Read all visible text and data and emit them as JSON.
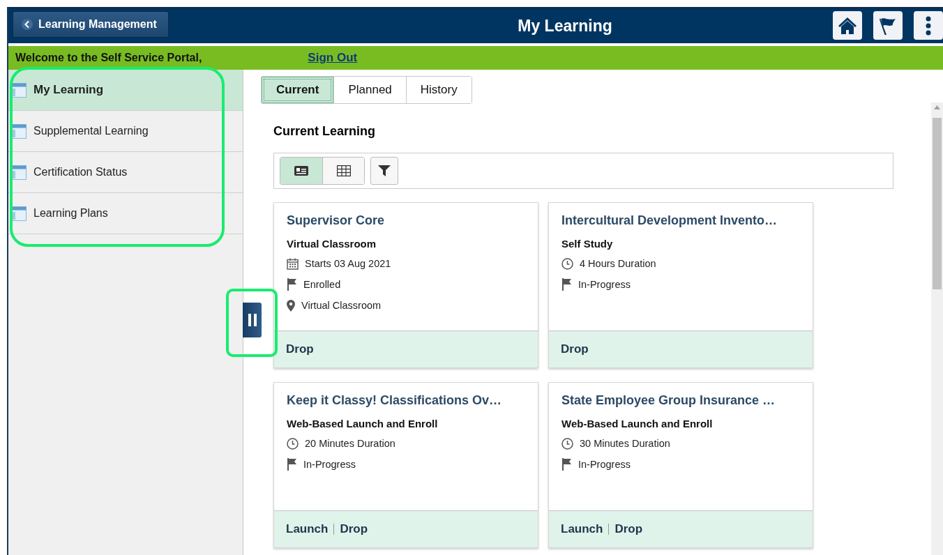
{
  "header": {
    "back_button": "Learning Management",
    "title": "My Learning"
  },
  "welcome_bar": {
    "message": "Welcome to the Self Service Portal,",
    "sign_out": "Sign Out"
  },
  "sidebar": {
    "highlighted": true,
    "items": [
      {
        "label": "My Learning",
        "selected": true
      },
      {
        "label": "Supplemental Learning",
        "selected": false
      },
      {
        "label": "Certification Status",
        "selected": false
      },
      {
        "label": "Learning Plans",
        "selected": false
      }
    ]
  },
  "collapse_handle": {
    "highlighted": true
  },
  "tabs": [
    {
      "label": "Current",
      "selected": true
    },
    {
      "label": "Planned",
      "selected": false
    },
    {
      "label": "History",
      "selected": false
    }
  ],
  "section_title": "Current Learning",
  "view_toggles": [
    {
      "kind": "card",
      "selected": true
    },
    {
      "kind": "grid",
      "selected": false
    }
  ],
  "cards": [
    {
      "title": "Supervisor Core",
      "type": "Virtual Classroom",
      "details": [
        {
          "kind": "calendar",
          "text": "Starts 03 Aug 2021"
        },
        {
          "kind": "flag",
          "text": "Enrolled"
        },
        {
          "kind": "location",
          "text": "Virtual Classroom"
        }
      ],
      "actions": [
        "Drop"
      ]
    },
    {
      "title": "Intercultural Development Invento…",
      "type": "Self Study",
      "details": [
        {
          "kind": "clock",
          "text": "4 Hours Duration"
        },
        {
          "kind": "flag",
          "text": "In-Progress"
        }
      ],
      "actions": [
        "Drop"
      ]
    },
    {
      "title": "Keep it Classy! Classifications Ov…",
      "type": "Web-Based Launch and Enroll",
      "details": [
        {
          "kind": "clock",
          "text": "20 Minutes Duration"
        },
        {
          "kind": "flag",
          "text": "In-Progress"
        }
      ],
      "actions": [
        "Launch",
        "Drop"
      ]
    },
    {
      "title": "State Employee Group Insurance …",
      "type": "Web-Based Launch and Enroll",
      "details": [
        {
          "kind": "clock",
          "text": "30 Minutes Duration"
        },
        {
          "kind": "flag",
          "text": "In-Progress"
        }
      ],
      "actions": [
        "Launch",
        "Drop"
      ]
    }
  ]
}
